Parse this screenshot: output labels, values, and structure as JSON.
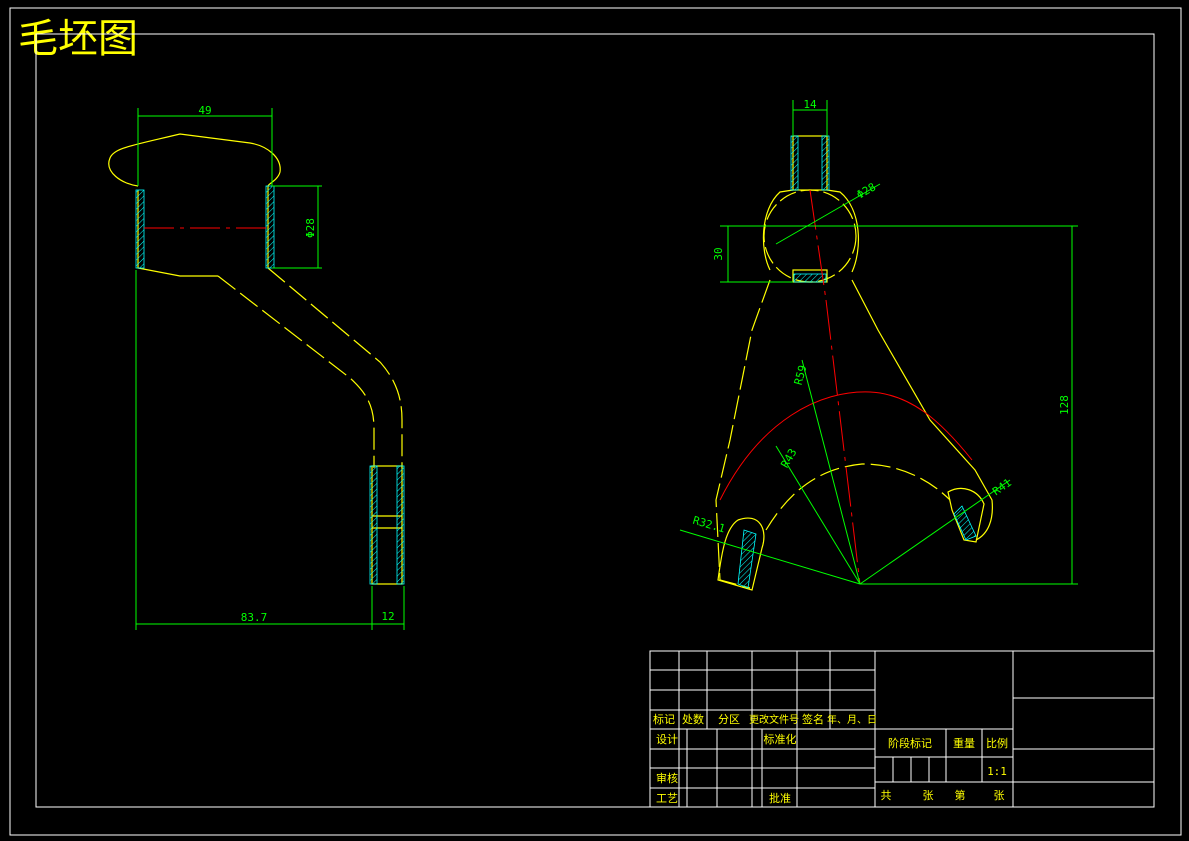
{
  "title": "毛坯图",
  "colors": {
    "background": "#000000",
    "outline": "#ffff00",
    "dimension": "#00ff00",
    "frame": "#ffffff",
    "centerline": "#ff0000",
    "hatch": "#00ffff"
  },
  "side_view": {
    "dims": {
      "top_width": "49",
      "bore_dia": "Φ28",
      "overall_length": "83.7",
      "foot_width": "12"
    }
  },
  "front_view": {
    "dims": {
      "top_width": "14",
      "hub_dia": "Φ28",
      "hub_height": "30",
      "overall_height": "128",
      "r_outer": "R59",
      "r_inner": "R43",
      "r_right": "R41",
      "r_left": "R32.1"
    }
  },
  "title_block": {
    "rev_header": [
      "标记",
      "处数",
      "分区",
      "更改文件号",
      "签名",
      "年、月、日"
    ],
    "design": "设计",
    "standardize": "标准化",
    "review": "审核",
    "process": "工艺",
    "approve": "批准",
    "stage_mark": "阶段标记",
    "weight": "重量",
    "scale_label": "比例",
    "scale": "1:1",
    "total": "共",
    "sheets": "张",
    "nth": "第",
    "sheet": "张"
  }
}
